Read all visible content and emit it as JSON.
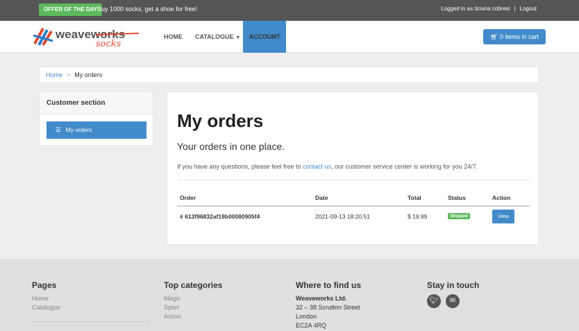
{
  "topbar": {
    "offer_badge": "OFFER OF THE DAY",
    "offer_text": "Buy 1000 socks, get a shoe for free!",
    "logged_in": "Logged in as ticiana cobresi",
    "separator": "|",
    "logout": "Logout"
  },
  "logo": {
    "main": "weaveworks",
    "sub": "socks"
  },
  "nav": {
    "home": "HOME",
    "catalogue": "CATALOGUE",
    "account": "ACCOUNT"
  },
  "cart": {
    "label": "0 items in cart"
  },
  "breadcrumb": {
    "home": "Home",
    "sep": ">",
    "current": "My orders"
  },
  "sidebar": {
    "title": "Customer section",
    "item": "My orders"
  },
  "main": {
    "title": "My orders",
    "lead": "Your orders in one place.",
    "info_prefix": "If you have any questions, please feel free to ",
    "info_link": "contact us",
    "info_suffix": ", our customer service center is working for you 24/7."
  },
  "orders_table": {
    "headers": [
      "Order",
      "Date",
      "Total",
      "Status",
      "Action"
    ],
    "rows": [
      {
        "order": "# 613f96832af19b00080905f4",
        "date": "2021-09-13 18:20:51",
        "total": "$ 19.99",
        "status": "Shipped",
        "action": "View"
      }
    ]
  },
  "footer": {
    "pages": {
      "title": "Pages",
      "links": [
        "Home",
        "Catalogue"
      ]
    },
    "categories": {
      "title": "Top categories",
      "links": [
        "Magic",
        "Sport",
        "Action"
      ]
    },
    "find_us": {
      "title": "Where to find us",
      "company": "Weaveworks Ltd.",
      "lines": [
        "32 – 38 Scrutton Street",
        "London",
        "EC2A 4RQ"
      ]
    },
    "stay": {
      "title": "Stay in touch",
      "icons": [
        "twitter-icon",
        "email-icon"
      ]
    }
  },
  "colors": {
    "accent": "#428bca",
    "offer": "#5cb85c",
    "topbar": "#555555"
  }
}
